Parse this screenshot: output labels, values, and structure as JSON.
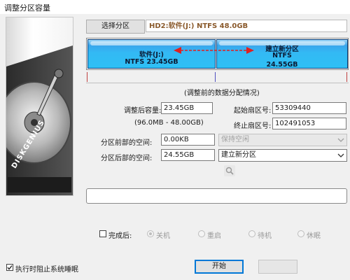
{
  "window": {
    "title": "调整分区容量"
  },
  "top": {
    "select_button": "选择分区",
    "disk_info": "HD2:软件(J:) NTFS 48.0GB"
  },
  "partitions": [
    {
      "line1": "软件(J:)",
      "line2": "NTFS 23.45GB"
    },
    {
      "line1": "建立新分区",
      "line2": "NTFS",
      "line3": "24.55GB"
    }
  ],
  "form": {
    "caption": "(调整前的数据分配情况)",
    "size_label": "调整后容量:",
    "size_value": "23.45GB",
    "size_range": "(96.0MB - 48.00GB)",
    "start_sector_label": "起始扇区号:",
    "start_sector_value": "53309440",
    "end_sector_label": "终止扇区号:",
    "end_sector_value": "102491053",
    "before_label": "分区前部的空间:",
    "before_value": "0.00KB",
    "before_option": "保持空闲",
    "after_label": "分区后部的空间:",
    "after_value": "24.55GB",
    "after_option": "建立新分区"
  },
  "completion": {
    "checkbox_label": "完成后:",
    "options": [
      "关机",
      "重启",
      "待机",
      "休眠"
    ],
    "selected_index": 0
  },
  "bottom": {
    "prevent_sleep_label": "执行时阻止系统睡眠",
    "prevent_sleep_checked": true,
    "start_button": "开始",
    "cancel_button": ""
  },
  "branding": {
    "logo_text": "DISKGENIUS"
  },
  "colors": {
    "partition_fill": "#33b9f4",
    "arrow": "#e02020",
    "accent_border": "#0078d7"
  }
}
